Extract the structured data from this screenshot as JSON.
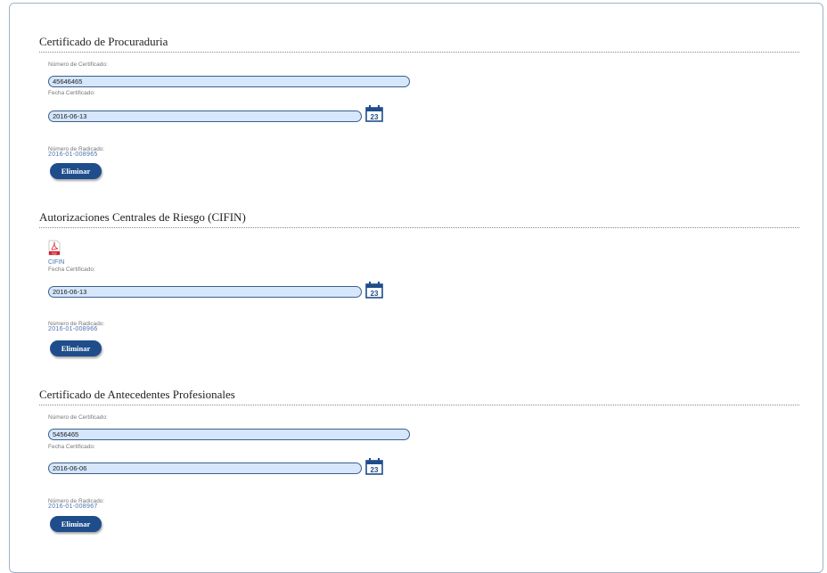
{
  "sections": [
    {
      "title": "Certificado de Procuraduria",
      "cert_number_label": "Número de Certificado:",
      "cert_number_value": "45646465",
      "date_label": "Fecha Certificado:",
      "date_value": "2016-06-13",
      "calendar_day": "23",
      "radicado_label": "Número de Radicado:",
      "radicado_value": "2016-01-008965",
      "delete_label": "Eliminar"
    },
    {
      "title": "Autorizaciones Centrales de Riesgo (CIFIN)",
      "file_link": "CIFIN",
      "pdf_label": "PDF",
      "date_label": "Fecha Certificado:",
      "date_value": "2016-06-13",
      "calendar_day": "23",
      "radicado_label": "Número de Radicado:",
      "radicado_value": "2016-01-008966",
      "delete_label": "Eliminar"
    },
    {
      "title": "Certificado de Antecedentes Profesionales",
      "cert_number_label": "Número de Certificado:",
      "cert_number_value": "5456465",
      "date_label": "Fecha Certificado:",
      "date_value": "2016-06-06",
      "calendar_day": "23",
      "radicado_label": "Número de Radicado:",
      "radicado_value": "2016-01-008967",
      "delete_label": "Eliminar"
    }
  ],
  "colors": {
    "field_bg": "#d6e6fb",
    "field_border": "#3b5f8e",
    "button_bg": "#1f4d8c",
    "calendar": "#1f4d8c",
    "link": "#4a72b0",
    "pdf_red": "#d71f26"
  },
  "icons": [
    "calendar-icon",
    "pdf-file-icon"
  ]
}
